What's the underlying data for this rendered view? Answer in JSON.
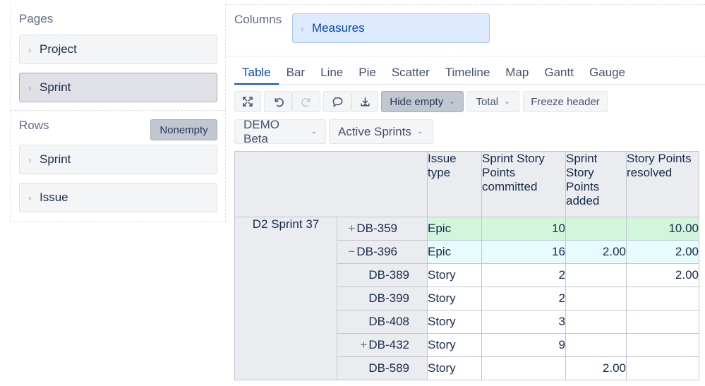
{
  "pages": {
    "label": "Pages",
    "items": [
      {
        "label": "Project",
        "selected": false
      },
      {
        "label": "Sprint",
        "selected": true
      }
    ]
  },
  "rows": {
    "label": "Rows",
    "nonempty_label": "Nonempty",
    "items": [
      {
        "label": "Sprint"
      },
      {
        "label": "Issue"
      }
    ]
  },
  "columns": {
    "label": "Columns",
    "items": [
      {
        "label": "Measures"
      }
    ]
  },
  "tabs": [
    "Table",
    "Bar",
    "Line",
    "Pie",
    "Scatter",
    "Timeline",
    "Map",
    "Gantt",
    "Gauge"
  ],
  "active_tab": "Table",
  "toolbar": {
    "fullscreen_icon": "expand-icon",
    "undo_icon": "undo-icon",
    "redo_icon": "redo-icon",
    "comment_icon": "comment-icon",
    "export_icon": "download-icon",
    "hide_empty_label": "Hide empty",
    "total_label": "Total",
    "freeze_header_label": "Freeze header"
  },
  "filters": {
    "project": "DEMO Beta",
    "sprint": "Active Sprints"
  },
  "table": {
    "headers": {
      "issue_type": "Issue type",
      "committed": "Sprint Story Points committed",
      "added": "Sprint Story Points added",
      "resolved": "Story Points resolved"
    },
    "sprint": "D2 Sprint 37",
    "rows": [
      {
        "issue": "DB-359",
        "expander": "+",
        "type": "Epic",
        "committed": "10",
        "added": "",
        "resolved": "10.00"
      },
      {
        "issue": "DB-396",
        "expander": "−",
        "type": "Epic",
        "committed": "16",
        "added": "2.00",
        "resolved": "2.00"
      },
      {
        "issue": "DB-389",
        "expander": "",
        "type": "Story",
        "committed": "2",
        "added": "",
        "resolved": "2.00"
      },
      {
        "issue": "DB-399",
        "expander": "",
        "type": "Story",
        "committed": "2",
        "added": "",
        "resolved": ""
      },
      {
        "issue": "DB-408",
        "expander": "",
        "type": "Story",
        "committed": "3",
        "added": "",
        "resolved": ""
      },
      {
        "issue": "DB-432",
        "expander": "+",
        "type": "Story",
        "committed": "9",
        "added": "",
        "resolved": ""
      },
      {
        "issue": "DB-589",
        "expander": "",
        "type": "Story",
        "committed": "",
        "added": "2.00",
        "resolved": ""
      }
    ]
  },
  "colors": {
    "accent": "#0052cc",
    "epic_green": "#d3f5dc",
    "epic_blue": "#e6fcff",
    "measures_chip": "#deebff"
  }
}
